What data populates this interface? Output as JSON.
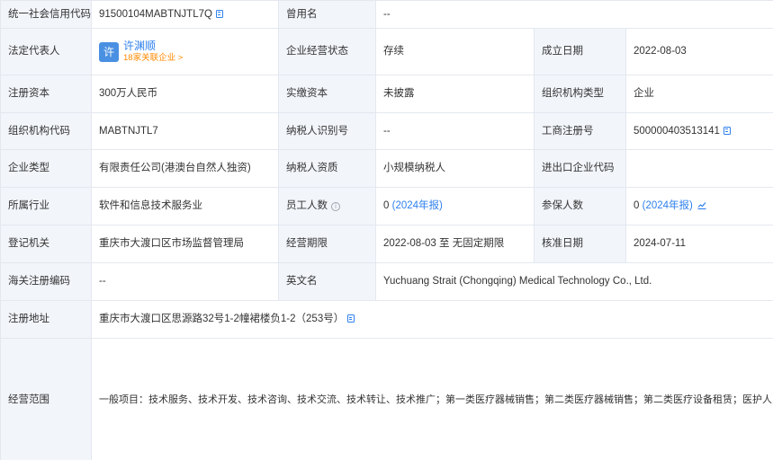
{
  "rows": [
    {
      "c1_label": "统一社会信用代码",
      "c1_value": "91500104MABTNJTL7Q",
      "c2_label": "曾用名",
      "c2_value": "--"
    },
    {
      "c1_label": "法定代表人",
      "rep_avatar": "许",
      "rep_name": "许渊顺",
      "rep_sub": "18家关联企业 >",
      "c2_label": "企业经营状态",
      "c2_value": "存续",
      "c3_label": "成立日期",
      "c3_value": "2022-08-03"
    },
    {
      "c1_label": "注册资本",
      "c1_value": "300万人民币",
      "c2_label": "实缴资本",
      "c2_value": "未披露",
      "c3_label": "组织机构类型",
      "c3_value": "企业"
    },
    {
      "c1_label": "组织机构代码",
      "c1_value": "MABTNJTL7",
      "c2_label": "纳税人识别号",
      "c2_value": "--",
      "c3_label": "工商注册号",
      "c3_value": "500000403513141"
    },
    {
      "c1_label": "企业类型",
      "c1_value": "有限责任公司(港澳台自然人独资)",
      "c2_label": "纳税人资质",
      "c2_value": "小规模纳税人",
      "c3_label": "进出口企业代码",
      "c3_value": ""
    },
    {
      "c1_label": "所属行业",
      "c1_value": "软件和信息技术服务业",
      "c2_label": "员工人数",
      "c2_value": "0",
      "c2_year": "(2024年报)",
      "c3_label": "参保人数",
      "c3_value": "0",
      "c3_year": "(2024年报)"
    },
    {
      "c1_label": "登记机关",
      "c1_value": "重庆市大渡口区市场监督管理局",
      "c2_label": "经营期限",
      "c2_value": "2022-08-03 至 无固定期限",
      "c3_label": "核准日期",
      "c3_value": "2024-07-11"
    },
    {
      "c1_label": "海关注册编码",
      "c1_value": "--",
      "c2_label": "英文名",
      "c2_value": "Yuchuang Strait (Chongqing) Medical Technology Co., Ltd."
    },
    {
      "c1_label": "注册地址",
      "c1_value": "重庆市大渡口区思源路32号1-2幢裙楼负1-2（253号）"
    },
    {
      "c1_label": "经营范围",
      "c1_value": "一般项目：技术服务、技术开发、技术咨询、技术交流、技术转让、技术推广；第一类医疗器械销售；第二类医疗器械销售；第二类医疗设备租赁；医护人员防护用品零售；互联网数据服务；物联网应用服务；物联网技术服务；物联网设备销售；网络技术服务；图文设计制作；广告制作；广告发布；广告设计、代理；软件开发；网络与信息安全软件开发；网络设备销售；日用品出租；充电控制设备租赁；计算机及通讯设备租赁；机械设备租赁；办公设备租赁服务；文化用品设备出租；互联网销售（除销售需要许可的商品）；软件销售；专业设计服务；信息咨询服务（不含许可类信息咨询服务）；日用品销售；体育用品及器材零售；家具销售；金属制品销售；市场营销策划；货物进出口；技术进出口；会议及展览服务；特种设备销售；汽车销售；制冷、空调设备销售；日用化学产品销售；化妆品零售；教学专用仪器销售；环境保护专用设备销售；办公设备销售；云计算设备销售；五金产品零售；日用百货销售；针纺织品销售；服装服饰零售；厨具卫具及日用杂品批发；建筑装饰材料销售；电子产品销售；企业管理咨询；销售代理；新材料技术研发；机械设备研发；电子专用材料研发；生物基材料技术研发。（除依法须经批准的项目外，凭营业执照依法自主开展经营活动）"
    }
  ],
  "colors": {
    "label_bg": "#f2f5fa",
    "border": "#e4e8ef",
    "link": "#2f80ed",
    "orange": "#ff8a00",
    "avatar": "#4a90e2"
  }
}
